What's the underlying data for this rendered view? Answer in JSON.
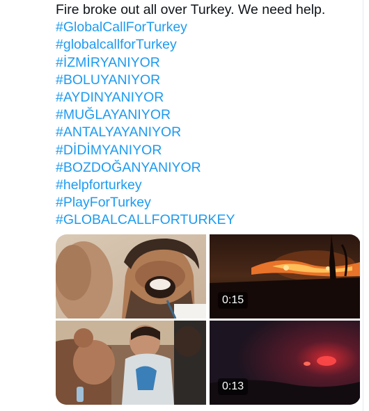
{
  "tweet": {
    "text": "Fire broke out all over Turkey. We need help.",
    "hashtags": [
      "#GlobalCallForTurkey",
      "#globalcallforTurkey",
      "#İZMİRYANIYOR",
      "#BOLUYANIYOR",
      "#AYDINYANIYOR",
      "#MUĞLAYANIYOR",
      "#ANTALYAYANIYOR",
      "#DİDİMYANIYOR",
      "#BOZDOĞANYANIYOR",
      "#helpforturkey",
      "#PlayForTurkey",
      "#GLOBALCALLFORTURKEY"
    ]
  },
  "media": {
    "video1_duration": "0:15",
    "video2_duration": "0:13"
  },
  "colors": {
    "text": "#0f1419",
    "link": "#1d9bf0",
    "badge_bg": "rgba(0,0,0,0.62)"
  }
}
